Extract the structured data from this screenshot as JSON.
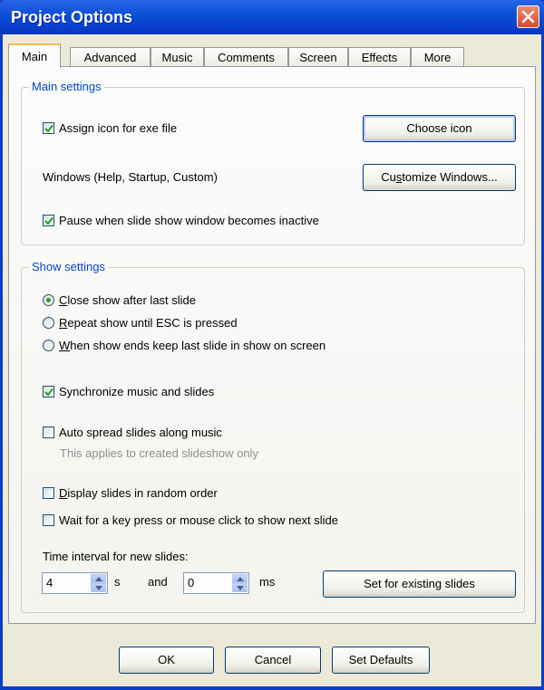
{
  "window": {
    "title": "Project Options"
  },
  "tabs": [
    "Main",
    "Advanced",
    "Music",
    "Comments",
    "Screen",
    "Effects",
    "More"
  ],
  "main_settings": {
    "group_title": "Main settings",
    "assign_icon_label": "Assign icon for exe file",
    "assign_icon_checked": true,
    "choose_icon_button": "Choose icon",
    "windows_label": "Windows (Help, Startup, Custom)",
    "customize_windows_button_pre": "Cu",
    "customize_windows_button_u": "s",
    "customize_windows_button_post": "tomize Windows...",
    "pause_label": "Pause when slide show window becomes inactive",
    "pause_checked": true
  },
  "show_settings": {
    "group_title": "Show settings",
    "radio_close_u": "C",
    "radio_close_rest": "lose show after last slide",
    "radio_repeat_u": "R",
    "radio_repeat_rest": "epeat show until ESC is pressed",
    "radio_keep_u": "W",
    "radio_keep_rest": "hen show ends keep last slide in show on screen",
    "selected_radio": "close",
    "sync_label": "Synchronize music and slides",
    "sync_checked": true,
    "auto_spread_label": "Auto spread slides along music",
    "auto_spread_checked": false,
    "auto_spread_note": "This applies to created slideshow only",
    "random_u": "D",
    "random_rest": "isplay slides in random order",
    "random_checked": false,
    "wait_label": "Wait for a key press or mouse click to show next slide",
    "wait_checked": false,
    "interval_label": "Time interval for new slides:",
    "seconds_value": "4",
    "seconds_unit": "s",
    "and_label": "and",
    "ms_value": "0",
    "ms_unit": "ms",
    "set_existing_button": "Set for existing slides"
  },
  "footer": {
    "ok_button": "OK",
    "cancel_button": "Cancel",
    "defaults_button": "Set Defaults"
  },
  "colors": {
    "title_bar": "#0b4fd6",
    "group_title": "#0046d5",
    "dialog_bg": "#ece9d8",
    "check_mark": "#21a121"
  }
}
